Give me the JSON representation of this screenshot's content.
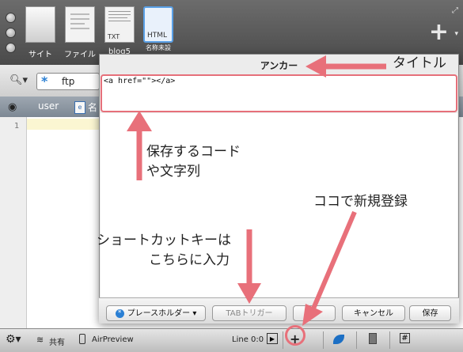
{
  "toolbar": {
    "items": [
      {
        "label": "サイト",
        "thumb_tag": ""
      },
      {
        "label": "ファイル",
        "thumb_tag": ""
      },
      {
        "label": "blog5",
        "thumb_tag": "TXT"
      },
      {
        "label": "名称未設",
        "thumb_tag": "HTML"
      }
    ],
    "add_icon": "plus-icon"
  },
  "search": {
    "value": "ftp",
    "icon": "search-icon"
  },
  "path": {
    "items": [
      "user",
      "名"
    ]
  },
  "editor": {
    "line_number": "1"
  },
  "dialog": {
    "title": "アンカー",
    "code": "<a href=\"\"></a>",
    "buttons": {
      "placeholder": "プレースホルダー",
      "placeholder_arrow": "▾",
      "tab_trigger": "TABトリガー",
      "blank": "",
      "cancel": "キャンセル",
      "save": "保存"
    }
  },
  "annotations": {
    "title": "タイトル",
    "code_line1": "保存するコード",
    "code_line2": "や文字列",
    "register": "ココで新規登録",
    "shortcut_line1": "ショートカットキーは",
    "shortcut_line2": "こちらに入力",
    "arrow_color": "#e8707a"
  },
  "statusbar": {
    "share": "共有",
    "airpreview": "AirPreview",
    "line": "Line 0:0",
    "add": "+"
  }
}
